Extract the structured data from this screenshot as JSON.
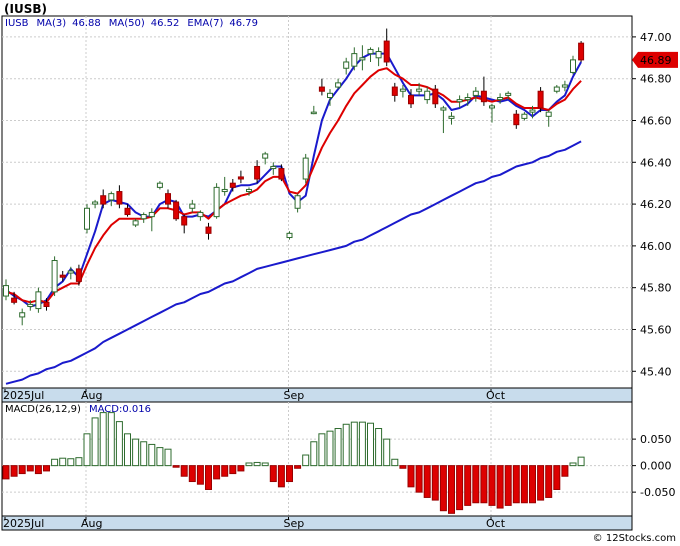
{
  "title": "(IUSB)",
  "watermark": "© 12Stocks.com",
  "colors": {
    "up": "#2e6b2e",
    "down": "#dd0000",
    "ma": "#1a1acc",
    "ema": "#dd0000",
    "macd_up": "#2e6b2e",
    "macd_down": "#dd0000",
    "axis_band": "#c8dcec",
    "price_badge": "#dd0000",
    "legend_text": "#0000aa"
  },
  "chart_data": [
    {
      "type": "candlestick",
      "legend": {
        "symbol": "IUSB",
        "items": [
          {
            "name": "MA(3)",
            "value": "46.88"
          },
          {
            "name": "MA(50)",
            "value": "46.52"
          },
          {
            "name": "EMA(7)",
            "value": "46.79"
          }
        ]
      },
      "last_price_label": "46.89",
      "ylim": [
        45.32,
        47.1
      ],
      "yticks": [
        "47.00",
        "46.80",
        "46.60",
        "46.40",
        "46.20",
        "46.00",
        "45.80",
        "45.60",
        "45.40"
      ],
      "x_labels": [
        {
          "index": 0,
          "label": "2025Jul"
        },
        {
          "index": 10,
          "label": "Aug"
        },
        {
          "index": 35,
          "label": "Sep"
        },
        {
          "index": 60,
          "label": "Oct"
        }
      ],
      "ohlc": [
        [
          45.76,
          45.84,
          45.74,
          45.81
        ],
        [
          45.75,
          45.78,
          45.72,
          45.73
        ],
        [
          45.66,
          45.7,
          45.62,
          45.68
        ],
        [
          45.71,
          45.74,
          45.69,
          45.72
        ],
        [
          45.7,
          45.8,
          45.68,
          45.78
        ],
        [
          45.73,
          45.75,
          45.69,
          45.71
        ],
        [
          45.78,
          45.95,
          45.76,
          45.93
        ],
        [
          45.86,
          45.88,
          45.83,
          45.85
        ],
        [
          45.87,
          45.9,
          45.84,
          45.88
        ],
        [
          45.89,
          45.91,
          45.81,
          45.83
        ],
        [
          46.08,
          46.2,
          46.06,
          46.18
        ],
        [
          46.2,
          46.22,
          46.18,
          46.21
        ],
        [
          46.24,
          46.27,
          46.18,
          46.2
        ],
        [
          46.22,
          46.26,
          46.19,
          46.25
        ],
        [
          46.26,
          46.29,
          46.18,
          46.2
        ],
        [
          46.18,
          46.2,
          46.14,
          46.15
        ],
        [
          46.1,
          46.13,
          46.09,
          46.12
        ],
        [
          46.13,
          46.16,
          46.11,
          46.15
        ],
        [
          46.14,
          46.18,
          46.07,
          46.16
        ],
        [
          46.28,
          46.31,
          46.27,
          46.3
        ],
        [
          46.25,
          46.27,
          46.18,
          46.2
        ],
        [
          46.21,
          46.22,
          46.12,
          46.13
        ],
        [
          46.14,
          46.15,
          46.06,
          46.1
        ],
        [
          46.18,
          46.22,
          46.16,
          46.2
        ],
        [
          46.14,
          46.17,
          46.12,
          46.16
        ],
        [
          46.09,
          46.11,
          46.03,
          46.06
        ],
        [
          46.14,
          46.3,
          46.13,
          46.28
        ],
        [
          46.26,
          46.33,
          46.24,
          46.27
        ],
        [
          46.3,
          46.32,
          46.26,
          46.28
        ],
        [
          46.33,
          46.36,
          46.3,
          46.32
        ],
        [
          46.26,
          46.28,
          46.24,
          46.27
        ],
        [
          46.38,
          46.41,
          46.3,
          46.32
        ],
        [
          46.42,
          46.45,
          46.39,
          46.44
        ],
        [
          46.37,
          46.4,
          46.34,
          46.38
        ],
        [
          46.37,
          46.39,
          46.31,
          46.32
        ],
        [
          46.04,
          46.07,
          46.03,
          46.06
        ],
        [
          46.18,
          46.25,
          46.16,
          46.24
        ],
        [
          46.32,
          46.44,
          46.3,
          46.42
        ],
        [
          46.64,
          46.67,
          46.63,
          46.64
        ],
        [
          46.76,
          46.8,
          46.72,
          46.74
        ],
        [
          46.71,
          46.75,
          46.67,
          46.73
        ],
        [
          46.76,
          46.8,
          46.75,
          46.78
        ],
        [
          46.85,
          46.9,
          46.82,
          46.88
        ],
        [
          46.86,
          46.95,
          46.84,
          46.92
        ],
        [
          46.89,
          46.96,
          46.84,
          46.9
        ],
        [
          46.92,
          46.95,
          46.88,
          46.94
        ],
        [
          46.9,
          46.95,
          46.86,
          46.93
        ],
        [
          46.98,
          47.04,
          46.86,
          46.88
        ],
        [
          46.76,
          46.78,
          46.69,
          46.72
        ],
        [
          46.74,
          46.77,
          46.71,
          46.75
        ],
        [
          46.72,
          46.75,
          46.66,
          46.68
        ],
        [
          46.74,
          46.78,
          46.72,
          46.75
        ],
        [
          46.7,
          46.76,
          46.68,
          46.74
        ],
        [
          46.75,
          46.77,
          46.66,
          46.68
        ],
        [
          46.65,
          46.67,
          46.54,
          46.66
        ],
        [
          46.61,
          46.64,
          46.58,
          46.62
        ],
        [
          46.69,
          46.72,
          46.66,
          46.7
        ],
        [
          46.7,
          46.73,
          46.67,
          46.71
        ],
        [
          46.72,
          46.76,
          46.69,
          46.74
        ],
        [
          46.74,
          46.81,
          46.67,
          46.69
        ],
        [
          46.66,
          46.68,
          46.59,
          46.67
        ],
        [
          46.7,
          46.73,
          46.68,
          46.71
        ],
        [
          46.72,
          46.74,
          46.7,
          46.73
        ],
        [
          46.63,
          46.65,
          46.56,
          46.58
        ],
        [
          46.61,
          46.64,
          46.6,
          46.63
        ],
        [
          46.64,
          46.67,
          46.61,
          46.65
        ],
        [
          46.74,
          46.76,
          46.64,
          46.66
        ],
        [
          46.62,
          46.65,
          46.57,
          46.64
        ],
        [
          46.74,
          46.77,
          46.73,
          46.76
        ],
        [
          46.76,
          46.79,
          46.74,
          46.77
        ],
        [
          46.83,
          46.91,
          46.82,
          46.89
        ],
        [
          46.97,
          46.98,
          46.88,
          46.89
        ]
      ],
      "series": [
        {
          "name": "MA(3)",
          "values": [
            45.79,
            45.76,
            45.74,
            45.71,
            45.72,
            45.74,
            45.8,
            45.83,
            45.89,
            45.85,
            45.96,
            46.07,
            46.2,
            46.22,
            46.21,
            46.2,
            46.16,
            46.14,
            46.14,
            46.2,
            46.22,
            46.21,
            46.14,
            46.14,
            46.15,
            46.14,
            46.17,
            46.2,
            46.28,
            46.29,
            46.29,
            46.3,
            46.34,
            46.38,
            46.38,
            46.25,
            46.21,
            46.24,
            46.43,
            46.6,
            46.7,
            46.75,
            46.8,
            46.86,
            46.9,
            46.92,
            46.92,
            46.92,
            46.85,
            46.78,
            46.72,
            46.72,
            46.72,
            46.73,
            46.7,
            46.65,
            46.66,
            46.68,
            46.72,
            46.71,
            46.7,
            46.69,
            46.7,
            46.67,
            46.65,
            46.62,
            46.65,
            46.65,
            46.69,
            46.72,
            46.81,
            46.88
          ]
        },
        {
          "name": "EMA(7)",
          "values": [
            45.78,
            45.77,
            45.74,
            45.73,
            45.74,
            45.73,
            45.78,
            45.8,
            45.82,
            45.82,
            45.91,
            45.99,
            46.05,
            46.1,
            46.13,
            46.13,
            46.13,
            46.13,
            46.14,
            46.18,
            46.18,
            46.17,
            46.15,
            46.16,
            46.16,
            46.13,
            46.17,
            46.2,
            46.22,
            46.24,
            46.25,
            46.27,
            46.31,
            46.33,
            46.33,
            46.26,
            46.25,
            46.29,
            46.38,
            46.47,
            46.54,
            46.6,
            46.67,
            46.73,
            46.77,
            46.81,
            46.84,
            46.85,
            46.82,
            46.8,
            46.77,
            46.77,
            46.76,
            46.74,
            46.72,
            46.69,
            46.69,
            46.7,
            46.71,
            46.7,
            46.69,
            46.7,
            46.71,
            46.68,
            46.66,
            46.66,
            46.66,
            46.65,
            46.68,
            46.7,
            46.75,
            46.79
          ]
        },
        {
          "name": "MA(50)",
          "values": [
            45.34,
            45.35,
            45.36,
            45.38,
            45.39,
            45.41,
            45.42,
            45.44,
            45.45,
            45.47,
            45.49,
            45.51,
            45.54,
            45.56,
            45.58,
            45.6,
            45.62,
            45.64,
            45.66,
            45.68,
            45.7,
            45.72,
            45.73,
            45.75,
            45.77,
            45.78,
            45.8,
            45.82,
            45.83,
            45.85,
            45.87,
            45.89,
            45.9,
            45.91,
            45.92,
            45.93,
            45.94,
            45.95,
            45.96,
            45.97,
            45.98,
            45.99,
            46.0,
            46.02,
            46.03,
            46.05,
            46.07,
            46.09,
            46.11,
            46.13,
            46.15,
            46.16,
            46.18,
            46.2,
            46.22,
            46.24,
            46.26,
            46.28,
            46.3,
            46.31,
            46.33,
            46.34,
            46.36,
            46.38,
            46.39,
            46.4,
            46.42,
            46.43,
            46.45,
            46.46,
            46.48,
            46.5
          ]
        }
      ]
    },
    {
      "type": "bar",
      "legend": {
        "items": [
          {
            "name": "MACD(26,12,9)"
          },
          {
            "name": "MACD",
            "value": "0.016"
          }
        ]
      },
      "ylim": [
        -0.095,
        0.12
      ],
      "yticks": [
        "0.050",
        "0.000",
        "-0.050"
      ],
      "x_labels": [
        {
          "index": 0,
          "label": "2025Jul"
        },
        {
          "index": 10,
          "label": "Aug"
        },
        {
          "index": 35,
          "label": "Sep"
        },
        {
          "index": 60,
          "label": "Oct"
        }
      ],
      "values": [
        -0.025,
        -0.02,
        -0.015,
        -0.01,
        -0.015,
        -0.01,
        0.012,
        0.014,
        0.013,
        0.015,
        0.06,
        0.09,
        0.1,
        0.1,
        0.083,
        0.06,
        0.05,
        0.045,
        0.04,
        0.034,
        0.031,
        -0.003,
        -0.02,
        -0.03,
        -0.035,
        -0.045,
        -0.025,
        -0.02,
        -0.015,
        -0.01,
        0.005,
        0.006,
        0.005,
        -0.03,
        -0.04,
        -0.03,
        -0.005,
        0.02,
        0.045,
        0.06,
        0.065,
        0.07,
        0.078,
        0.082,
        0.082,
        0.08,
        0.07,
        0.05,
        0.012,
        -0.005,
        -0.04,
        -0.05,
        -0.06,
        -0.065,
        -0.085,
        -0.09,
        -0.083,
        -0.075,
        -0.07,
        -0.07,
        -0.075,
        -0.08,
        -0.075,
        -0.07,
        -0.07,
        -0.07,
        -0.065,
        -0.06,
        -0.045,
        -0.02,
        0.005,
        0.016
      ]
    }
  ]
}
